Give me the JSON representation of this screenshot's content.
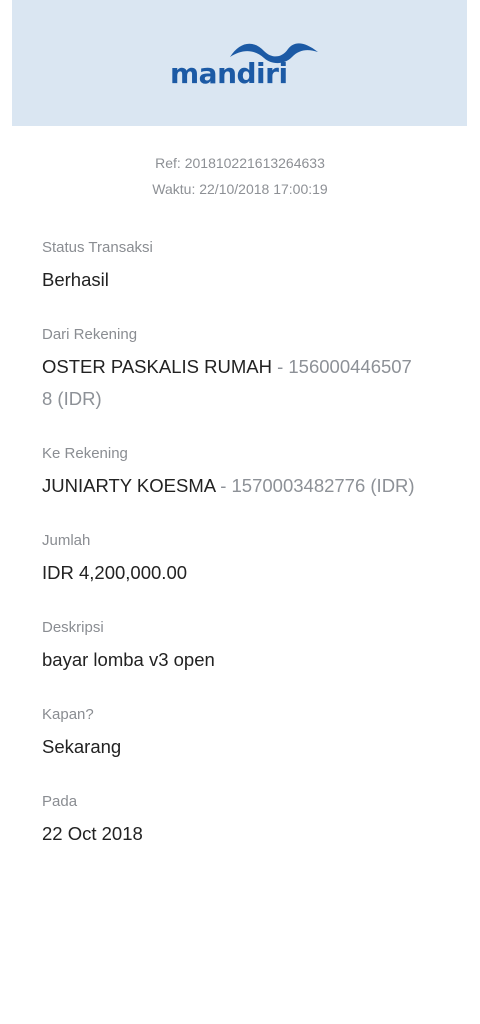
{
  "header": {
    "logo_text": "mandiri",
    "brand_color": "#1c5aa5",
    "background_color": "#dae6f2"
  },
  "meta": {
    "ref": "Ref: 201810221613264633",
    "waktu": "Waktu: 22/10/2018 17:00:19"
  },
  "fields": {
    "status": {
      "label": "Status Transaksi",
      "value": "Berhasil"
    },
    "dari": {
      "label": "Dari Rekening",
      "name": "OSTER PASKALIS RUMAH",
      "account": "- 1560004465078 (IDR)"
    },
    "ke": {
      "label": "Ke Rekening",
      "name": "JUNIARTY KOESMA",
      "account": "- 1570003482776 (IDR)"
    },
    "jumlah": {
      "label": "Jumlah",
      "value": "IDR 4,200,000.00"
    },
    "deskripsi": {
      "label": "Deskripsi",
      "value": "bayar lomba v3 open"
    },
    "kapan": {
      "label": "Kapan?",
      "value": "Sekarang"
    },
    "pada": {
      "label": "Pada",
      "value": "22 Oct 2018"
    }
  }
}
